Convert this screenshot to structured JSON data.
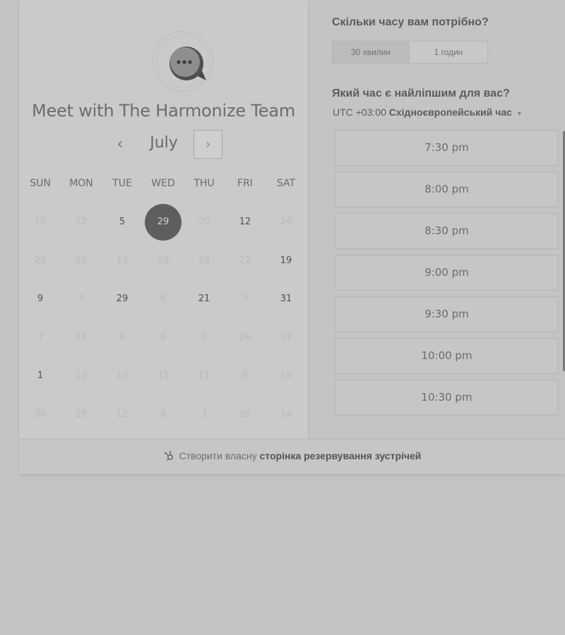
{
  "calendar": {
    "title": "Meet with The Harmonize Team",
    "month": "July",
    "prev_glyph": "‹",
    "next_glyph": "›",
    "weekdays": [
      "SUN",
      "MON",
      "TUE",
      "WED",
      "THU",
      "FRI",
      "SAT"
    ],
    "selected_day": "29",
    "weeks": [
      [
        {
          "d": "10",
          "on": false
        },
        {
          "d": "12",
          "on": false
        },
        {
          "d": "5",
          "on": true
        },
        {
          "d": "29",
          "on": true,
          "sel": true
        },
        {
          "d": "20",
          "on": false
        },
        {
          "d": "12",
          "on": true
        },
        {
          "d": "24",
          "on": false
        }
      ],
      [
        {
          "d": "28",
          "on": false
        },
        {
          "d": "11",
          "on": false
        },
        {
          "d": "13",
          "on": false
        },
        {
          "d": "28",
          "on": false
        },
        {
          "d": "28",
          "on": false
        },
        {
          "d": "22",
          "on": false
        },
        {
          "d": "19",
          "on": true
        }
      ],
      [
        {
          "d": "9",
          "on": true
        },
        {
          "d": "4",
          "on": false
        },
        {
          "d": "29",
          "on": true
        },
        {
          "d": "6",
          "on": false
        },
        {
          "d": "21",
          "on": true
        },
        {
          "d": "3",
          "on": false
        },
        {
          "d": "31",
          "on": true
        }
      ],
      [
        {
          "d": "7",
          "on": false
        },
        {
          "d": "28",
          "on": false
        },
        {
          "d": "6",
          "on": false
        },
        {
          "d": "6",
          "on": false
        },
        {
          "d": "3",
          "on": false
        },
        {
          "d": "26",
          "on": false
        },
        {
          "d": "17",
          "on": false
        }
      ],
      [
        {
          "d": "1",
          "on": true
        },
        {
          "d": "13",
          "on": false
        },
        {
          "d": "10",
          "on": false
        },
        {
          "d": "15",
          "on": false
        },
        {
          "d": "11",
          "on": false
        },
        {
          "d": "6",
          "on": false
        },
        {
          "d": "18",
          "on": false
        }
      ],
      [
        {
          "d": "30",
          "on": false
        },
        {
          "d": "25",
          "on": false
        },
        {
          "d": "12",
          "on": false
        },
        {
          "d": "8",
          "on": false
        },
        {
          "d": "3",
          "on": false
        },
        {
          "d": "26",
          "on": false
        },
        {
          "d": "14",
          "on": false
        }
      ]
    ]
  },
  "duration": {
    "question": "Скільки часу вам потрібно?",
    "options": [
      "30 хвилин",
      "1 годин"
    ],
    "selected": "30 хвилин"
  },
  "timeslots": {
    "question": "Який час є найліпшим для вас?",
    "tz_offset": "UTC +03:00",
    "tz_name": "Східноєвропейський час",
    "tz_caret": "▾",
    "slots": [
      "7:30 pm",
      "8:00 pm",
      "8:30 pm",
      "9:00 pm",
      "9:30 pm",
      "10:00 pm",
      "10:30 pm"
    ]
  },
  "footer": {
    "prefix": "Створити власну",
    "link": "сторінка резервування зустрічей"
  }
}
